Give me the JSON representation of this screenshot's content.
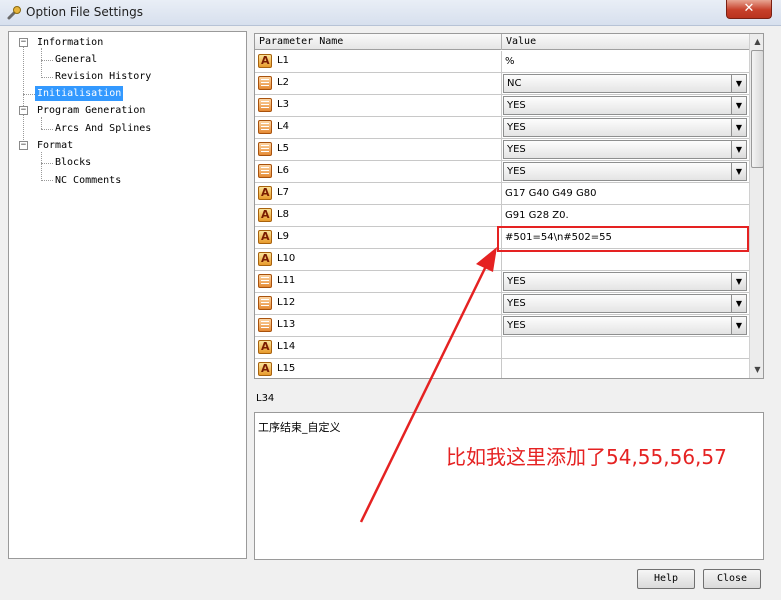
{
  "window": {
    "title": "Option File Settings",
    "close_glyph": "✕"
  },
  "tree": {
    "items": [
      {
        "label": "Information",
        "expander": "−"
      },
      {
        "label": "General"
      },
      {
        "label": "Revision History"
      },
      {
        "label": "Initialisation"
      },
      {
        "label": "Program Generation",
        "expander": "−"
      },
      {
        "label": "Arcs And Splines"
      },
      {
        "label": "Format",
        "expander": "−"
      },
      {
        "label": "Blocks"
      },
      {
        "label": "NC Comments"
      }
    ]
  },
  "grid": {
    "columns": [
      "Parameter Name",
      "Value"
    ],
    "rows": [
      {
        "label": "L1",
        "icon": "text-param-icon",
        "value": "%"
      },
      {
        "label": "L2",
        "icon": "list-param-icon",
        "value": "NC",
        "combo": true
      },
      {
        "label": "L3",
        "icon": "list-param-icon",
        "value": "YES",
        "combo": true
      },
      {
        "label": "L4",
        "icon": "list-param-icon",
        "value": "YES",
        "combo": true
      },
      {
        "label": "L5",
        "icon": "list-param-icon",
        "value": "YES",
        "combo": true
      },
      {
        "label": "L6",
        "icon": "list-param-icon",
        "value": "YES",
        "combo": true
      },
      {
        "label": "L7",
        "icon": "text-param-icon",
        "value": "G17 G40 G49 G80"
      },
      {
        "label": "L8",
        "icon": "text-param-icon",
        "value": "G91 G28 Z0."
      },
      {
        "label": "L9",
        "icon": "text-param-icon",
        "value": "#501=54\\n#502=55"
      },
      {
        "label": "L10",
        "icon": "text-param-icon",
        "value": ""
      },
      {
        "label": "L11",
        "icon": "list-param-icon",
        "value": "YES",
        "combo": true
      },
      {
        "label": "L12",
        "icon": "list-param-icon",
        "value": "YES",
        "combo": true
      },
      {
        "label": "L13",
        "icon": "list-param-icon",
        "value": "YES",
        "combo": true
      },
      {
        "label": "L14",
        "icon": "text-param-icon",
        "value": ""
      },
      {
        "label": "L15",
        "icon": "text-param-icon",
        "value": ""
      }
    ],
    "combo_arrow": "▼"
  },
  "scroll": {
    "up": "▲",
    "down": "▼"
  },
  "description": {
    "label": "L34",
    "text": "工序结束_自定义"
  },
  "annotation": {
    "text": "比如我这里添加了54,55,56,57",
    "color": "#e52222"
  },
  "buttons": {
    "help": "Help",
    "close": "Close"
  },
  "colors": {
    "selection": "#3399ff",
    "annotation_red": "#e52222"
  }
}
